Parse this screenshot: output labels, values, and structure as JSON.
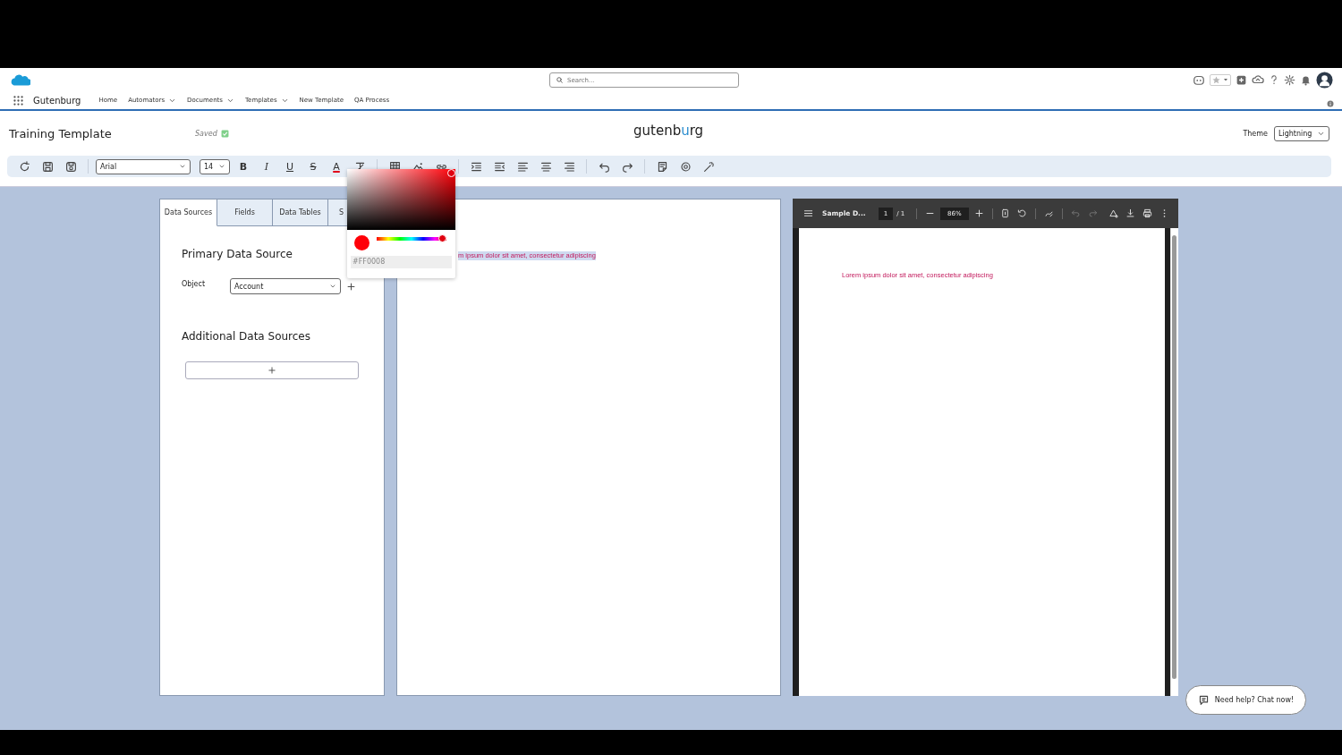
{
  "header": {
    "search": {
      "placeholder": "Search..."
    },
    "app_name": "Gutenburg",
    "nav": [
      {
        "label": "Home",
        "dropdown": false
      },
      {
        "label": "Automators",
        "dropdown": true
      },
      {
        "label": "Documents",
        "dropdown": true
      },
      {
        "label": "Templates",
        "dropdown": true
      },
      {
        "label": "New Template",
        "dropdown": false
      },
      {
        "label": "QA Process",
        "dropdown": false
      }
    ]
  },
  "title_bar": {
    "title": "Training Template",
    "status": "Saved",
    "logo": [
      "gutenb",
      "u",
      "rg"
    ],
    "theme_label": "Theme",
    "theme_value": "Lightning"
  },
  "toolbar": {
    "font": "Arial",
    "size": "14",
    "format": [
      "B",
      "I",
      "U",
      "S",
      "A"
    ]
  },
  "left_panel": {
    "tabs": [
      {
        "label": "Data Sources",
        "selected": true
      },
      {
        "label": "Fields",
        "selected": false
      },
      {
        "label": "Data Tables",
        "selected": false
      },
      {
        "label": "S",
        "selected": false
      }
    ],
    "primary_heading": "Primary Data Source",
    "object_label": "Object",
    "object_value": "Account",
    "additional_heading": "Additional Data Sources"
  },
  "editor": {
    "text": "m ipsum dolor sit amet, consectetur adipiscing",
    "selected": true
  },
  "color_picker": {
    "hex": "#FF0008",
    "hue_slider": {
      "level": 1
    }
  },
  "pdf_viewer": {
    "file_name": "Sample D...",
    "page": "1",
    "page_total": "/ 1",
    "zoom": "86%",
    "text": "Lorem ipsum dolor sit amet, consectetur adipiscing"
  },
  "chat_button": "Need help? Chat now!"
}
